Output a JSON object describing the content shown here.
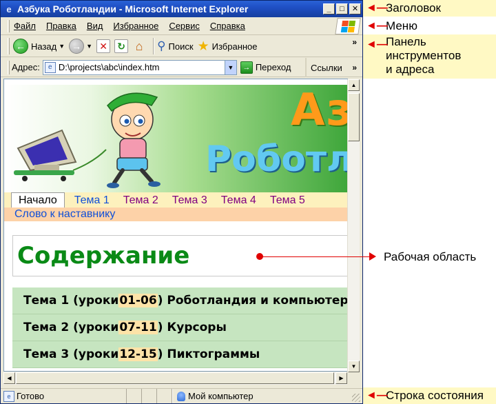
{
  "window": {
    "title": "Азбука Роботландии - Microsoft Internet Explorer",
    "buttons": {
      "minimize": "_",
      "maximize": "□",
      "close": "✕"
    }
  },
  "menu": {
    "items": [
      "Файл",
      "Правка",
      "Вид",
      "Избранное",
      "Сервис",
      "Справка"
    ]
  },
  "toolbar": {
    "back_label": "Назад",
    "search_label": "Поиск",
    "favorites_label": "Избранное",
    "more": "»"
  },
  "address": {
    "label": "Адрес:",
    "value": "D:\\projects\\abc\\index.htm",
    "go_label": "Переход",
    "links_label": "Ссылки",
    "more": "»"
  },
  "page": {
    "banner": {
      "title_top": "Аз",
      "title_bottom": "Роботл"
    },
    "nav": {
      "tabs": [
        "Начало",
        "Тема 1",
        "Тема 2",
        "Тема 3",
        "Тема 4",
        "Тема 5"
      ],
      "mentor_link": "Слово к наставнику"
    },
    "heading": "Содержание",
    "topics": [
      {
        "prefix": "Тема 1 (уроки ",
        "range": "01-06",
        "suffix": ") Роботландия и компьютеры"
      },
      {
        "prefix": "Тема 2 (уроки ",
        "range": "07-11",
        "suffix": ") Курсоры"
      },
      {
        "prefix": "Тема 3 (уроки ",
        "range": "12-15",
        "suffix": ") Пиктограммы"
      }
    ]
  },
  "status": {
    "text": "Готово",
    "zone": "Мой компьютер"
  },
  "annotations": {
    "title": "Заголовок",
    "menu": "Меню",
    "toolbar_line1": "Панель",
    "toolbar_line2": "инструментов",
    "toolbar_line3": "и адреса",
    "workarea": "Рабочая область",
    "status": "Строка состояния"
  },
  "colors": {
    "titlebar": "#2a62d6",
    "heading": "#0a8a16",
    "topic_bg": "#c6e5c0",
    "nav_bg": "#fdf1bd",
    "mentor_bg": "#fdd2a8",
    "annotation_bg": "#fff9c4",
    "annotation_arrow": "#e00000"
  }
}
